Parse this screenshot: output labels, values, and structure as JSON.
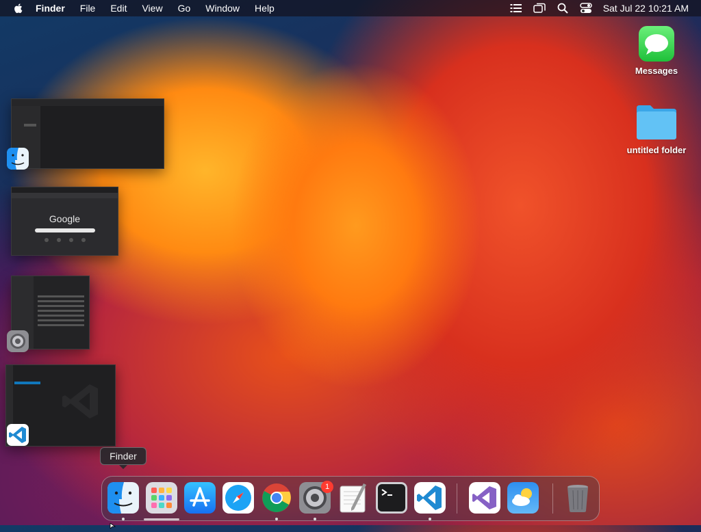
{
  "menubar": {
    "app_name": "Finder",
    "menus": [
      "File",
      "Edit",
      "View",
      "Go",
      "Window",
      "Help"
    ],
    "status_icons": [
      "list-icon",
      "screen-mirror-icon",
      "search-icon",
      "control-center-icon"
    ],
    "clock": "Sat Jul 22  10:21 AM"
  },
  "desktop": {
    "icons": [
      {
        "label": "Messages",
        "icon": "messages-icon"
      },
      {
        "label": "untitled folder",
        "icon": "folder-icon"
      }
    ]
  },
  "stage_manager": {
    "groups": [
      {
        "app": "Finder",
        "icon": "finder-icon"
      },
      {
        "app": "Google Chrome",
        "icon": "chrome-icon",
        "page_logo": "Google"
      },
      {
        "app": "System Settings",
        "icon": "settings-icon"
      },
      {
        "app": "Visual Studio Code",
        "icon": "vscode-icon"
      }
    ]
  },
  "tooltip": {
    "text": "Finder"
  },
  "dock": {
    "items": [
      {
        "name": "Finder",
        "icon": "finder-icon",
        "running": true
      },
      {
        "name": "Launchpad",
        "icon": "launchpad-icon",
        "running": false
      },
      {
        "name": "App Store",
        "icon": "app-store-icon",
        "running": false
      },
      {
        "name": "Safari",
        "icon": "safari-icon",
        "running": false
      },
      {
        "name": "Google Chrome",
        "icon": "chrome-icon",
        "running": true
      },
      {
        "name": "System Settings",
        "icon": "settings-icon",
        "running": true,
        "badge": "1"
      },
      {
        "name": "TextEdit",
        "icon": "textedit-icon",
        "running": false
      },
      {
        "name": "Terminal",
        "icon": "terminal-icon",
        "running": false
      },
      {
        "name": "Visual Studio Code",
        "icon": "vscode-icon",
        "running": true
      },
      {
        "name": "Visual Studio",
        "icon": "visual-studio-icon",
        "running": false
      },
      {
        "name": "Weather",
        "icon": "weather-icon",
        "running": false
      },
      {
        "name": "Trash",
        "icon": "trash-icon",
        "running": false
      }
    ]
  }
}
